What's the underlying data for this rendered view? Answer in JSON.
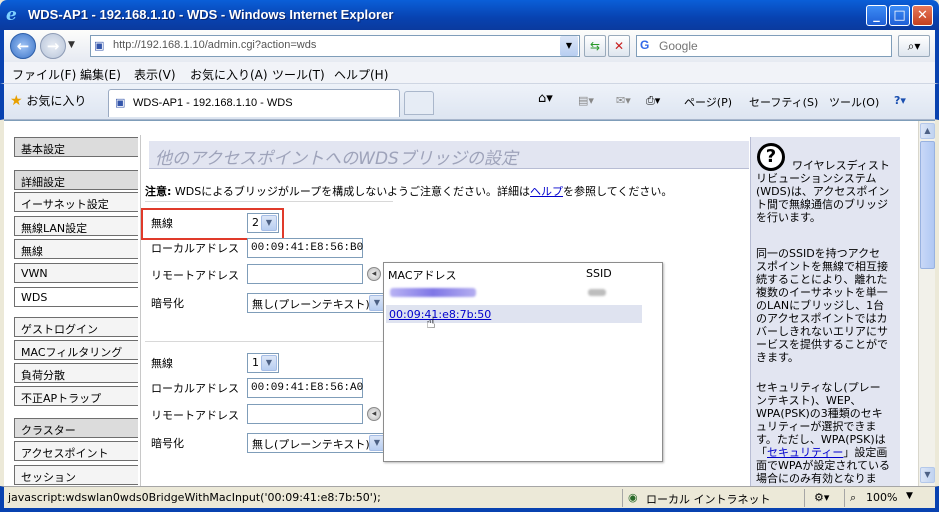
{
  "window": {
    "title": "WDS-AP1 - 192.168.1.10 - WDS - Windows Internet Explorer"
  },
  "address": {
    "url": "http://192.168.1.10/admin.cgi?action=wds"
  },
  "search": {
    "placeholder": "Google"
  },
  "menu": {
    "file": "ファイル(F)",
    "edit": "編集(E)",
    "view": "表示(V)",
    "favorites": "お気に入り(A)",
    "tools": "ツール(T)",
    "help": "ヘルプ(H)"
  },
  "favbar": {
    "favorites_label": "お気に入り",
    "tab_title": "WDS-AP1 - 192.168.1.10 - WDS",
    "page": "ページ(P)",
    "safety": "セーフティ(S)",
    "tools": "ツール(O)"
  },
  "sidebar": {
    "items": [
      {
        "label": "基本設定"
      },
      {
        "label": "詳細設定"
      },
      {
        "label": "イーサネット設定"
      },
      {
        "label": "無線LAN設定"
      },
      {
        "label": "無線"
      },
      {
        "label": "VWN"
      },
      {
        "label": "WDS"
      },
      {
        "label": "ゲストログイン"
      },
      {
        "label": "MACフィルタリング"
      },
      {
        "label": "負荷分散"
      },
      {
        "label": "不正APトラップ"
      },
      {
        "label": "クラスター"
      },
      {
        "label": "アクセスポイント"
      },
      {
        "label": "セッション"
      }
    ]
  },
  "main": {
    "heading": "他のアクセスポイントへのWDSブリッジの設定",
    "note_label": "注意:",
    "note_text": " WDSによるブリッジがループを構成しないようご注意ください。詳細は",
    "note_link": "ヘルプ",
    "note_tail": "を参照してください。",
    "bridges": [
      {
        "radio_label": "無線",
        "radio_value": "2",
        "local_label": "ローカルアドレス",
        "local_value": "00:09:41:E8:56:B0",
        "remote_label": "リモートアドレス",
        "remote_value": "",
        "enc_label": "暗号化",
        "enc_value": "無し(プレーンテキスト)"
      },
      {
        "radio_label": "無線",
        "radio_value": "1",
        "local_label": "ローカルアドレス",
        "local_value": "00:09:41:E8:56:A0",
        "remote_label": "リモートアドレス",
        "remote_value": "",
        "enc_label": "暗号化",
        "enc_value": "無し(プレーンテキスト)"
      }
    ]
  },
  "popup": {
    "col_mac": "MACアドレス",
    "col_ssid": "SSID",
    "highlight_mac": "00:09:41:e8:7b:50"
  },
  "help": {
    "p1": "ワイヤレスディストリビューションシステム(WDS)は、アクセスポイント間で無線通信のブリッジを行います。",
    "p2": "同一のSSIDを持つアクセスポイントを無線で相互接続することにより、離れた複数のイーサネットを単一のLANにブリッジし、1台のアクセスポイントではカバーしきれないエリアにサービスを提供することができます。",
    "p3": "セキュリティなし(プレーンテキスト)、WEP、WPA(PSK)の3種類のセキュリティーが選択できます。ただし、WPA(PSK)は「",
    "p3_link": "セキュリティー",
    "p3_tail": "」設定画面でWPAが設定されている場合にのみ有効となりま"
  },
  "status": {
    "text": "javascript:wdswlan0wds0BridgeWithMacInput('00:09:41:e8:7b:50');",
    "zone": "ローカル イントラネット",
    "zoom": "100%"
  }
}
